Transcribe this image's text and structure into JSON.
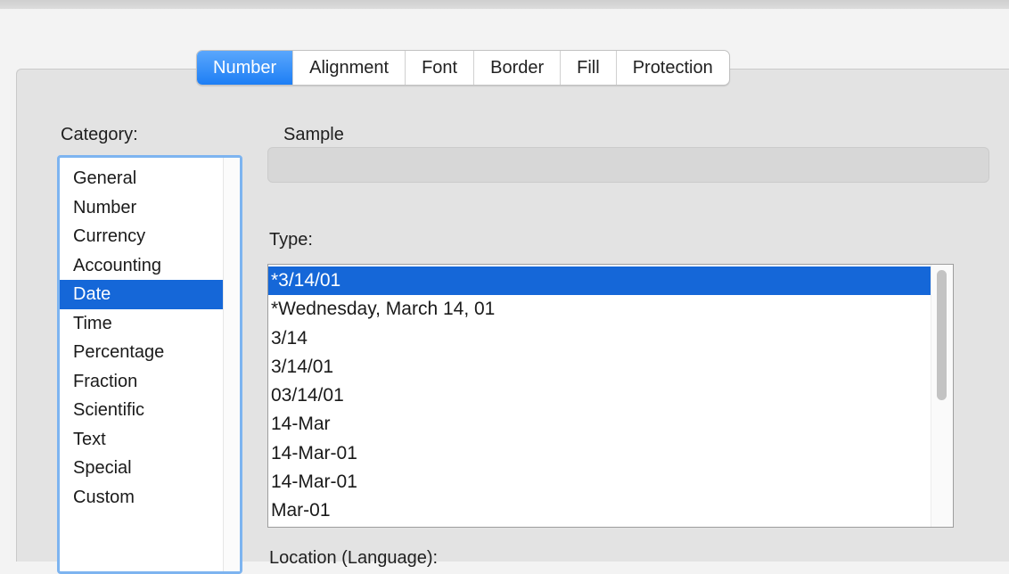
{
  "tabs": [
    {
      "label": "Number",
      "active": true
    },
    {
      "label": "Alignment",
      "active": false
    },
    {
      "label": "Font",
      "active": false
    },
    {
      "label": "Border",
      "active": false
    },
    {
      "label": "Fill",
      "active": false
    },
    {
      "label": "Protection",
      "active": false
    }
  ],
  "category": {
    "label": "Category:",
    "items": [
      "General",
      "Number",
      "Currency",
      "Accounting",
      "Date",
      "Time",
      "Percentage",
      "Fraction",
      "Scientific",
      "Text",
      "Special",
      "Custom"
    ],
    "selected": "Date"
  },
  "sample": {
    "label": "Sample",
    "value": ""
  },
  "type": {
    "label": "Type:",
    "items": [
      "*3/14/01",
      "*Wednesday, March 14, 01",
      "3/14",
      "3/14/01",
      "03/14/01",
      "14-Mar",
      "14-Mar-01",
      "14-Mar-01",
      "Mar-01"
    ],
    "selected_index": 0
  },
  "location": {
    "label": "Location (Language):"
  },
  "colors": {
    "accent": "#1567d8",
    "focus_ring": "#7db4f0",
    "tab_active": "#2b88f7",
    "panel_bg": "#e3e3e3"
  }
}
